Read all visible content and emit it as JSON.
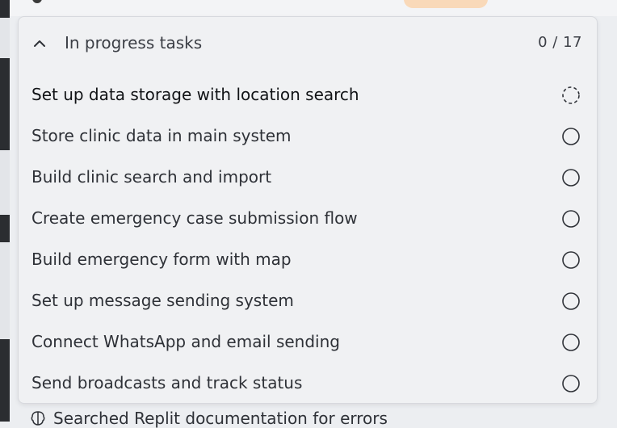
{
  "panel": {
    "title": "In progress tasks",
    "count": "0 / 17",
    "tasks": [
      {
        "label": "Set up data storage with location search",
        "status": "in-progress"
      },
      {
        "label": "Store clinic data in main system",
        "status": "pending"
      },
      {
        "label": "Build clinic search and import",
        "status": "pending"
      },
      {
        "label": "Create emergency case submission flow",
        "status": "pending"
      },
      {
        "label": "Build emergency form with map",
        "status": "pending"
      },
      {
        "label": "Set up message sending system",
        "status": "pending"
      },
      {
        "label": "Connect WhatsApp and email sending",
        "status": "pending"
      },
      {
        "label": "Send broadcasts and track status",
        "status": "pending"
      }
    ]
  },
  "bottom": {
    "text": "Searched Replit documentation for errors",
    "icon": "brain-icon"
  },
  "colors": {
    "panel_bg": "#f0f1f3",
    "accent_pill": "#f9d9b9",
    "text": "#2e3137"
  }
}
